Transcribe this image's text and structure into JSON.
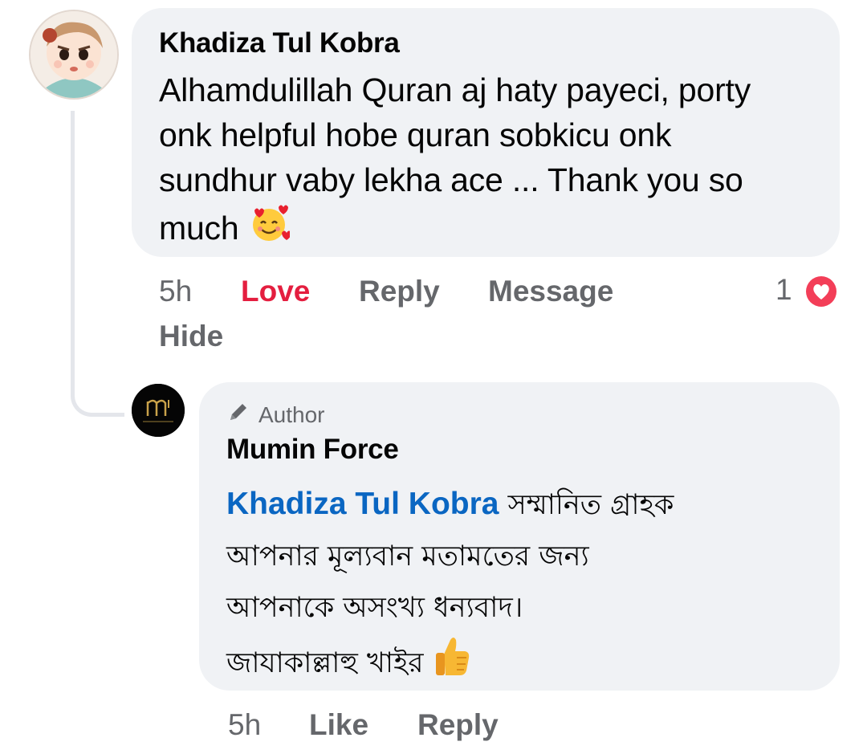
{
  "comment": {
    "author": "Khadiza Tul Kobra",
    "text_lines": [
      "Alhamdulillah Quran aj haty payeci, porty",
      "onk helpful hobe quran sobkicu onk",
      "sundhur vaby lekha ace ... Thank you so",
      "much"
    ],
    "emoji": "smiling-face-with-hearts",
    "time": "5h",
    "love_label": "Love",
    "reply_label": "Reply",
    "message_label": "Message",
    "hide_label": "Hide",
    "reaction_count": "1",
    "reaction_type": "heart",
    "love_color": "#e41e3f"
  },
  "reply": {
    "author_badge": "Author",
    "author": "Mumin Force",
    "mention": "Khadiza Tul Kobra",
    "text_lines": [
      "সম্মানিত গ্রাহক",
      "আপনার মূল্যবান মতামতের জন্য",
      "আপনাকে অসংখ্য ধন্যবাদ।",
      "জাযাকাল্লাহু খাইর"
    ],
    "emoji": "thumbs-up",
    "time": "5h",
    "like_label": "Like",
    "reply_label": "Reply",
    "mention_color": "#0a66c2"
  }
}
